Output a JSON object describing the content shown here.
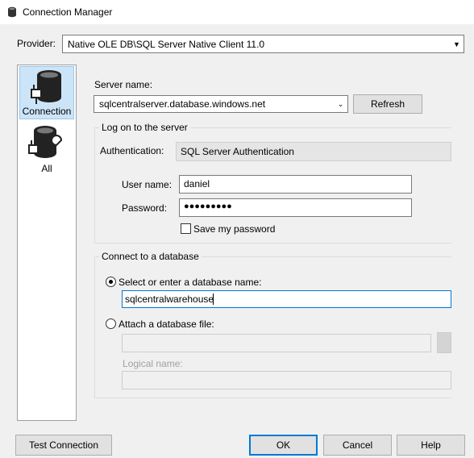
{
  "window": {
    "title": "Connection Manager"
  },
  "provider": {
    "label": "Provider:",
    "value": "Native OLE DB\\SQL Server Native Client 11.0"
  },
  "sidebar": {
    "items": [
      {
        "label": "Connection"
      },
      {
        "label": "All"
      }
    ]
  },
  "server": {
    "label": "Server name:",
    "value": "sqlcentralserver.database.windows.net",
    "refresh_label": "Refresh"
  },
  "logon": {
    "group_title": "Log on to the server",
    "auth_label": "Authentication:",
    "auth_value": "SQL Server Authentication",
    "user_label": "User name:",
    "user_value": "daniel",
    "password_label": "Password:",
    "password_value": "●●●●●●●●●",
    "save_password_label": "Save my password"
  },
  "database": {
    "group_title": "Connect to a database",
    "select_label": "Select or enter a database name:",
    "select_value": "sqlcentralwarehouse",
    "attach_label": "Attach a database file:",
    "logical_name_label": "Logical name:"
  },
  "footer": {
    "test_label": "Test Connection",
    "ok_label": "OK",
    "cancel_label": "Cancel",
    "help_label": "Help"
  }
}
